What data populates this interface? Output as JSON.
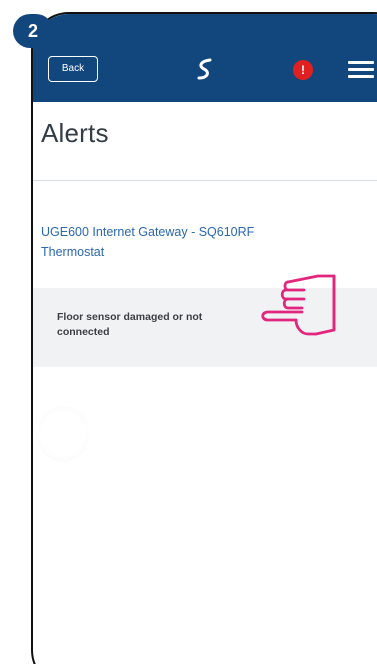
{
  "step_badge": "2",
  "header": {
    "back_label": "Back",
    "logo_icon": "s-logo-icon",
    "alert_icon": "alert-badge-icon",
    "alert_badge_glyph": "!",
    "menu_icon": "hamburger-menu-icon",
    "background_color": "#12477e"
  },
  "page": {
    "title": "Alerts"
  },
  "device": {
    "name": "UGE600 Internet Gateway - SQ610RF Thermostat"
  },
  "alert": {
    "message": "Floor sensor damaged or not connected"
  },
  "pointer_icon": "pointing-hand-icon",
  "colors": {
    "accent": "#12477e",
    "link": "#2a67b1",
    "alert_red": "#e02020",
    "hand_pink": "#e2267d"
  }
}
